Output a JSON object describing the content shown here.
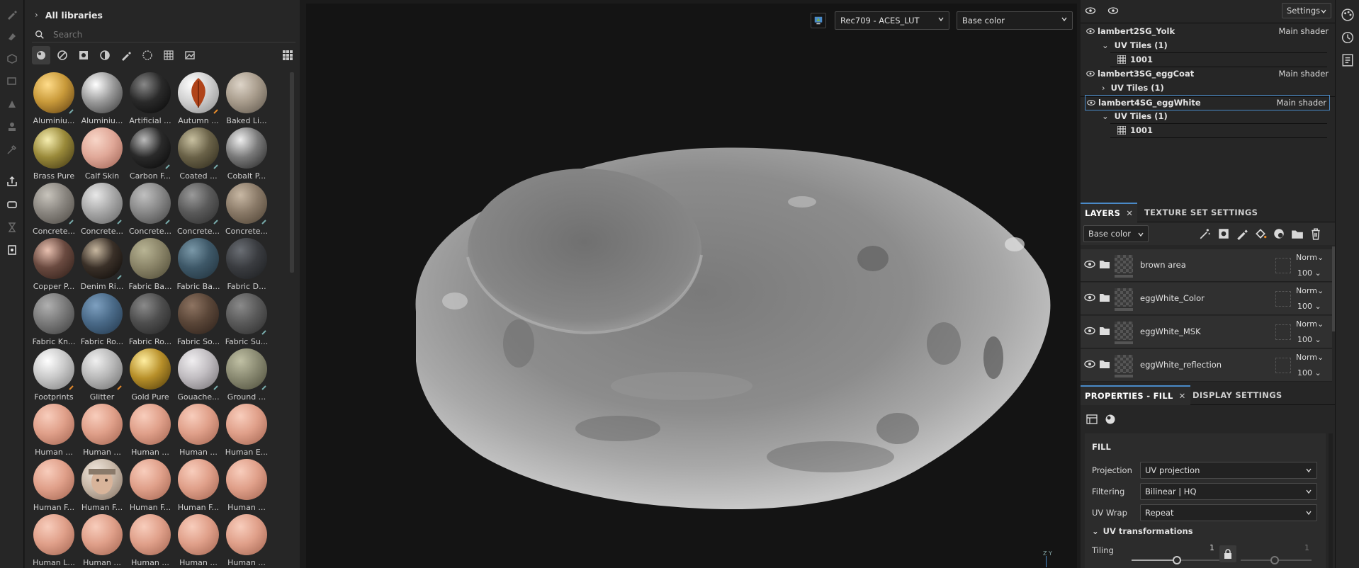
{
  "library": {
    "header": "All libraries",
    "search_placeholder": "Search",
    "materials": [
      {
        "label": "Aluminiu...",
        "color": "#c99a3a",
        "hi": "#ffdc8a",
        "lo": "#5a3a10",
        "badge": "#7aa"
      },
      {
        "label": "Aluminiu...",
        "color": "#9a9a9a",
        "hi": "#ffffff",
        "lo": "#333333"
      },
      {
        "label": "Artificial ...",
        "color": "#2a2a2a",
        "hi": "#888888",
        "lo": "#050505"
      },
      {
        "label": "Autumn ...",
        "color": "#d0d0d0",
        "hi": "#ffffff",
        "lo": "#888888",
        "badge": "#e58a2a",
        "leaf": true
      },
      {
        "label": "Baked Li...",
        "color": "#a89c8c",
        "hi": "#ddd4c8",
        "lo": "#5a5248"
      },
      {
        "label": "Brass Pure",
        "color": "#9a8a3a",
        "hi": "#f6eeb0",
        "lo": "#3a3010"
      },
      {
        "label": "Calf Skin",
        "color": "#e0a898",
        "hi": "#f8d6c8",
        "lo": "#9a5e50"
      },
      {
        "label": "Carbon F...",
        "color": "#2a2a2a",
        "hi": "#bbbbbb",
        "lo": "#050505",
        "badge": "#7aa"
      },
      {
        "label": "Coated ...",
        "color": "#6a6248",
        "hi": "#c8c0a0",
        "lo": "#2a2618",
        "badge": "#7aa"
      },
      {
        "label": "Cobalt P...",
        "color": "#7a7a7a",
        "hi": "#eeeeee",
        "lo": "#202020"
      },
      {
        "label": "Concrete...",
        "color": "#8a8680",
        "hi": "#c8c4bc",
        "lo": "#4a4640",
        "badge": "#7aa"
      },
      {
        "label": "Concrete...",
        "color": "#a8a8a8",
        "hi": "#e8e8e8",
        "lo": "#606060",
        "badge": "#7aa"
      },
      {
        "label": "Concrete...",
        "color": "#888888",
        "hi": "#c0c0c0",
        "lo": "#404040",
        "badge": "#7aa"
      },
      {
        "label": "Concrete...",
        "color": "#5a5a5a",
        "hi": "#9a9a9a",
        "lo": "#2a2a2a",
        "badge": "#7aa"
      },
      {
        "label": "Concrete...",
        "color": "#8a7a68",
        "hi": "#c8b8a4",
        "lo": "#4a3e30",
        "badge": "#7aa"
      },
      {
        "label": "Copper P...",
        "color": "#6a4a40",
        "hi": "#e8c0b0",
        "lo": "#2a1a14"
      },
      {
        "label": "Denim Ri...",
        "color": "#3a3028",
        "hi": "#c8b8a0",
        "lo": "#0a0806",
        "badge": "#7aa"
      },
      {
        "label": "Fabric Ba...",
        "color": "#8a8468",
        "hi": "#b8b494",
        "lo": "#4a4632"
      },
      {
        "label": "Fabric Ba...",
        "color": "#3e5868",
        "hi": "#7a98a8",
        "lo": "#1e2e38"
      },
      {
        "label": "Fabric D...",
        "color": "#3a3c40",
        "hi": "#6a6e74",
        "lo": "#1a1c1e"
      },
      {
        "label": "Fabric Kn...",
        "color": "#7a7a7a",
        "hi": "#b0b0b0",
        "lo": "#3a3a3a"
      },
      {
        "label": "Fabric Ro...",
        "color": "#4a6a88",
        "hi": "#7ea0c0",
        "lo": "#203448"
      },
      {
        "label": "Fabric Ro...",
        "color": "#4e4e4e",
        "hi": "#8a8a8a",
        "lo": "#222222"
      },
      {
        "label": "Fabric So...",
        "color": "#5a4638",
        "hi": "#8e7462",
        "lo": "#2a1e18"
      },
      {
        "label": "Fabric Su...",
        "color": "#5a5a5a",
        "hi": "#8a8a8a",
        "lo": "#2a2a2a",
        "badge": "#7aa"
      },
      {
        "label": "Footprints",
        "color": "#c8c8c8",
        "hi": "#ffffff",
        "lo": "#7a7a7a",
        "badge": "#e58a2a"
      },
      {
        "label": "Glitter",
        "color": "#b8b8b8",
        "hi": "#f0f0f0",
        "lo": "#6a6a6a",
        "badge": "#e58a2a"
      },
      {
        "label": "Gold Pure",
        "color": "#b8902a",
        "hi": "#ffeea0",
        "lo": "#4a3608"
      },
      {
        "label": "Gouache...",
        "color": "#c0bcc0",
        "hi": "#f0eef0",
        "lo": "#706c70",
        "badge": "#7aa"
      },
      {
        "label": "Ground ...",
        "color": "#8a8a72",
        "hi": "#c0c0a4",
        "lo": "#4a4a38",
        "badge": "#7aa"
      },
      {
        "label": "Human ...",
        "color": "#e0a08a",
        "hi": "#f8cdbc",
        "lo": "#a0624e"
      },
      {
        "label": "Human ...",
        "color": "#e0a08a",
        "hi": "#f8cdbc",
        "lo": "#a0624e"
      },
      {
        "label": "Human ...",
        "color": "#e0a08a",
        "hi": "#f8cdbc",
        "lo": "#a0624e"
      },
      {
        "label": "Human ...",
        "color": "#e0a08a",
        "hi": "#f8cdbc",
        "lo": "#a0624e"
      },
      {
        "label": "Human E...",
        "color": "#e0a08a",
        "hi": "#f8cdbc",
        "lo": "#a0624e"
      },
      {
        "label": "Human F...",
        "color": "#e0a08a",
        "hi": "#f8cdbc",
        "lo": "#a0624e"
      },
      {
        "label": "Human F...",
        "color": "#c8b8a8",
        "hi": "#f0e6dc",
        "lo": "#806e60",
        "face": true
      },
      {
        "label": "Human F...",
        "color": "#e0a08a",
        "hi": "#f8cdbc",
        "lo": "#a0624e"
      },
      {
        "label": "Human F...",
        "color": "#e0a08a",
        "hi": "#f8cdbc",
        "lo": "#a0624e"
      },
      {
        "label": "Human ...",
        "color": "#e0a08a",
        "hi": "#f8cdbc",
        "lo": "#a0624e"
      },
      {
        "label": "Human L...",
        "color": "#e0a08a",
        "hi": "#f8cdbc",
        "lo": "#a0624e"
      },
      {
        "label": "Human ...",
        "color": "#e0a08a",
        "hi": "#f8cdbc",
        "lo": "#a0624e"
      },
      {
        "label": "Human ...",
        "color": "#e0a08a",
        "hi": "#f8cdbc",
        "lo": "#a0624e"
      },
      {
        "label": "Human ...",
        "color": "#e0a08a",
        "hi": "#f8cdbc",
        "lo": "#a0624e"
      },
      {
        "label": "Human ...",
        "color": "#e0a08a",
        "hi": "#f8cdbc",
        "lo": "#a0624e"
      }
    ]
  },
  "viewport": {
    "colorspace": "Rec709 - ACES_LUT",
    "channel": "Base color",
    "axis_label": "Z Y"
  },
  "texture_sets": {
    "settings_label": "Settings",
    "sets": [
      {
        "name": "lambert2SG_Yolk",
        "shader": "Main shader",
        "uv_tiles": "UV Tiles (1)",
        "tile": "1001",
        "expanded": true
      },
      {
        "name": "lambert3SG_eggCoat",
        "shader": "Main shader",
        "uv_tiles": "UV Tiles (1)",
        "expanded": false
      },
      {
        "name": "lambert4SG_eggWhite",
        "shader": "Main shader",
        "uv_tiles": "UV Tiles (1)",
        "tile": "1001",
        "expanded": true,
        "selected": true
      }
    ]
  },
  "layers_tabs": {
    "layers": "LAYERS",
    "texture_set_settings": "TEXTURE SET SETTINGS"
  },
  "layers": {
    "channel": "Base color",
    "items": [
      {
        "name": "brown area",
        "blend": "Norm",
        "opacity": "100"
      },
      {
        "name": "eggWhite_Color",
        "blend": "Norm",
        "opacity": "100"
      },
      {
        "name": "eggWhite_MSK",
        "blend": "Norm",
        "opacity": "100"
      },
      {
        "name": "eggWhite_reflection",
        "blend": "Norm",
        "opacity": "100"
      }
    ]
  },
  "props_tabs": {
    "properties": "PROPERTIES - FILL",
    "display": "DISPLAY SETTINGS"
  },
  "fill": {
    "title": "FILL",
    "projection_label": "Projection",
    "projection_value": "UV projection",
    "filtering_label": "Filtering",
    "filtering_value": "Bilinear | HQ",
    "uvwrap_label": "UV Wrap",
    "uvwrap_value": "Repeat",
    "uvtrans_label": "UV transformations",
    "tiling_label": "Tiling",
    "tiling_value": "1",
    "tiling_value2": "1"
  }
}
